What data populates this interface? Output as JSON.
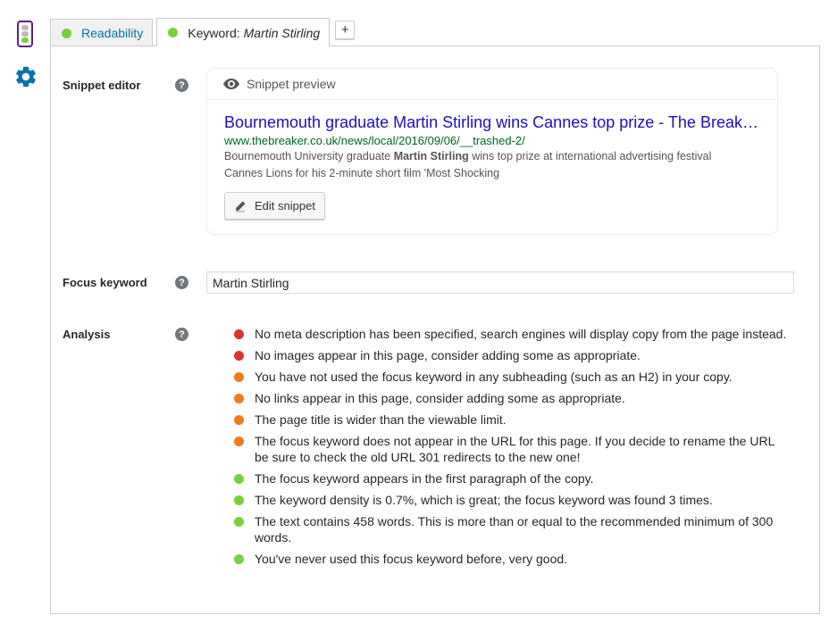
{
  "colors": {
    "good": "#7ad03a",
    "ok": "#ee7c1b",
    "bad": "#dc3232",
    "link": "#0073aa",
    "snippet_title": "#1e0fbe",
    "snippet_url": "#006621"
  },
  "sidebar": {
    "traffic_light_icon": "traffic-light-icon",
    "settings_icon": "gear-icon"
  },
  "tabs": [
    {
      "label": "Readability",
      "status": "good"
    },
    {
      "label": "Keyword:",
      "keyword": "Martin Stirling",
      "status": "good"
    }
  ],
  "add_tab_label": "+",
  "snippet_editor": {
    "label": "Snippet editor",
    "help": "?",
    "preview_heading": "Snippet preview",
    "title": "Bournemouth graduate Martin Stirling wins Cannes top prize - The Break…",
    "url": "www.thebreaker.co.uk/news/local/2016/09/06/__trashed-2/",
    "description_before": "Bournemouth University graduate ",
    "description_bold": "Martin Stirling",
    "description_after": " wins top prize at international advertising festival Cannes Lions for his 2-minute short film 'Most Shocking",
    "edit_button": "Edit snippet"
  },
  "focus_keyword": {
    "label": "Focus keyword",
    "help": "?",
    "value": "Martin Stirling"
  },
  "analysis": {
    "label": "Analysis",
    "help": "?",
    "items": [
      {
        "status": "bad",
        "text": "No meta description has been specified, search engines will display copy from the page instead."
      },
      {
        "status": "bad",
        "text": "No images appear in this page, consider adding some as appropriate."
      },
      {
        "status": "ok",
        "text": "You have not used the focus keyword in any subheading (such as an H2) in your copy."
      },
      {
        "status": "ok",
        "text": "No links appear in this page, consider adding some as appropriate."
      },
      {
        "status": "ok",
        "text": "The page title is wider than the viewable limit."
      },
      {
        "status": "ok",
        "text": "The focus keyword does not appear in the URL for this page. If you decide to rename the URL be sure to check the old URL 301 redirects to the new one!"
      },
      {
        "status": "good",
        "text": "The focus keyword appears in the first paragraph of the copy."
      },
      {
        "status": "good",
        "text": "The keyword density is 0.7%, which is great; the focus keyword was found 3 times."
      },
      {
        "status": "good",
        "text": "The text contains 458 words. This is more than or equal to the recommended minimum of 300 words."
      },
      {
        "status": "good",
        "text": "You've never used this focus keyword before, very good."
      }
    ]
  }
}
